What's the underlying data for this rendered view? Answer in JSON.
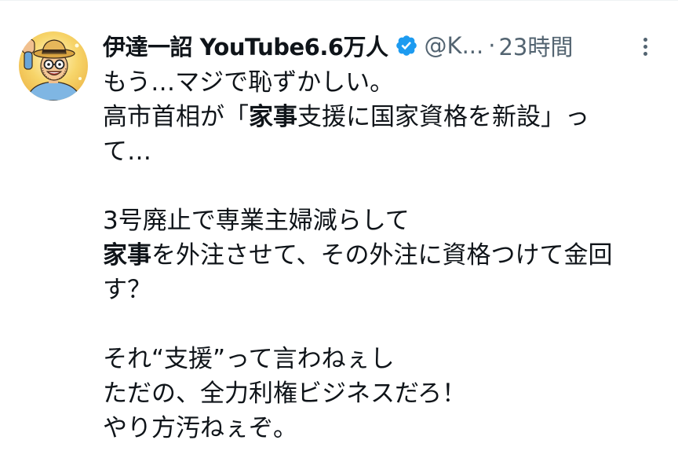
{
  "author": {
    "display_name": "伊達一詔 YouTube6.6万人",
    "handle": "@K...",
    "separator": "·",
    "time": "23時間",
    "verified": true,
    "verified_color": "#1d9bf0",
    "avatar_icon": "cartoon-man-avatar"
  },
  "more_icon": "more-vertical-icon",
  "tweet": {
    "line1": "もう…マジで恥ずかしい。",
    "line2_a": "高市首相が「",
    "line2_b": "家事",
    "line2_c": "支援に国家資格を新設」っ",
    "line3": "て…",
    "line4": "3号廃止で専業主婦減らして",
    "line5_a": "家事",
    "line5_b": "を外注させて、その外注に資格つけて金回",
    "line6": "す？",
    "line7": "それ“支援”って言わねぇし",
    "line8": "ただの、全力利権ビジネスだろ！",
    "line9": "やり方汚ねぇぞ。"
  },
  "colors": {
    "text": "#0f1419",
    "secondary": "#536471",
    "divider": "#eff3f4"
  }
}
